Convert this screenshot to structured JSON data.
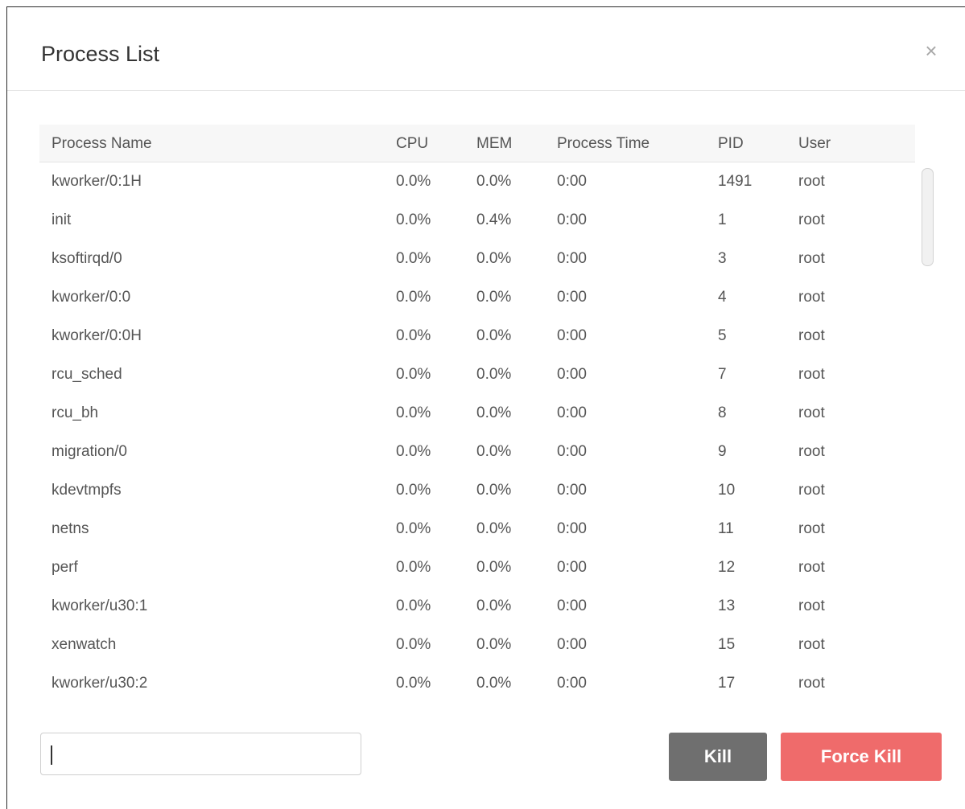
{
  "dialog": {
    "title": "Process List",
    "close_label": "×"
  },
  "table": {
    "headers": {
      "name": "Process Name",
      "cpu": "CPU",
      "mem": "MEM",
      "time": "Process Time",
      "pid": "PID",
      "user": "User"
    },
    "rows": [
      {
        "name": "kworker/0:1H",
        "cpu": "0.0%",
        "mem": "0.0%",
        "time": "0:00",
        "pid": "1491",
        "user": "root"
      },
      {
        "name": "init",
        "cpu": "0.0%",
        "mem": "0.4%",
        "time": "0:00",
        "pid": "1",
        "user": "root"
      },
      {
        "name": "ksoftirqd/0",
        "cpu": "0.0%",
        "mem": "0.0%",
        "time": "0:00",
        "pid": "3",
        "user": "root"
      },
      {
        "name": "kworker/0:0",
        "cpu": "0.0%",
        "mem": "0.0%",
        "time": "0:00",
        "pid": "4",
        "user": "root"
      },
      {
        "name": "kworker/0:0H",
        "cpu": "0.0%",
        "mem": "0.0%",
        "time": "0:00",
        "pid": "5",
        "user": "root"
      },
      {
        "name": "rcu_sched",
        "cpu": "0.0%",
        "mem": "0.0%",
        "time": "0:00",
        "pid": "7",
        "user": "root"
      },
      {
        "name": "rcu_bh",
        "cpu": "0.0%",
        "mem": "0.0%",
        "time": "0:00",
        "pid": "8",
        "user": "root"
      },
      {
        "name": "migration/0",
        "cpu": "0.0%",
        "mem": "0.0%",
        "time": "0:00",
        "pid": "9",
        "user": "root"
      },
      {
        "name": "kdevtmpfs",
        "cpu": "0.0%",
        "mem": "0.0%",
        "time": "0:00",
        "pid": "10",
        "user": "root"
      },
      {
        "name": "netns",
        "cpu": "0.0%",
        "mem": "0.0%",
        "time": "0:00",
        "pid": "11",
        "user": "root"
      },
      {
        "name": "perf",
        "cpu": "0.0%",
        "mem": "0.0%",
        "time": "0:00",
        "pid": "12",
        "user": "root"
      },
      {
        "name": "kworker/u30:1",
        "cpu": "0.0%",
        "mem": "0.0%",
        "time": "0:00",
        "pid": "13",
        "user": "root"
      },
      {
        "name": "xenwatch",
        "cpu": "0.0%",
        "mem": "0.0%",
        "time": "0:00",
        "pid": "15",
        "user": "root"
      },
      {
        "name": "kworker/u30:2",
        "cpu": "0.0%",
        "mem": "0.0%",
        "time": "0:00",
        "pid": "17",
        "user": "root"
      }
    ]
  },
  "footer": {
    "filter_value": "",
    "kill_label": "Kill",
    "force_kill_label": "Force Kill"
  },
  "colors": {
    "kill_button": "#6f6f6f",
    "force_kill_button": "#ef6b6b",
    "header_background": "#f7f7f7"
  }
}
